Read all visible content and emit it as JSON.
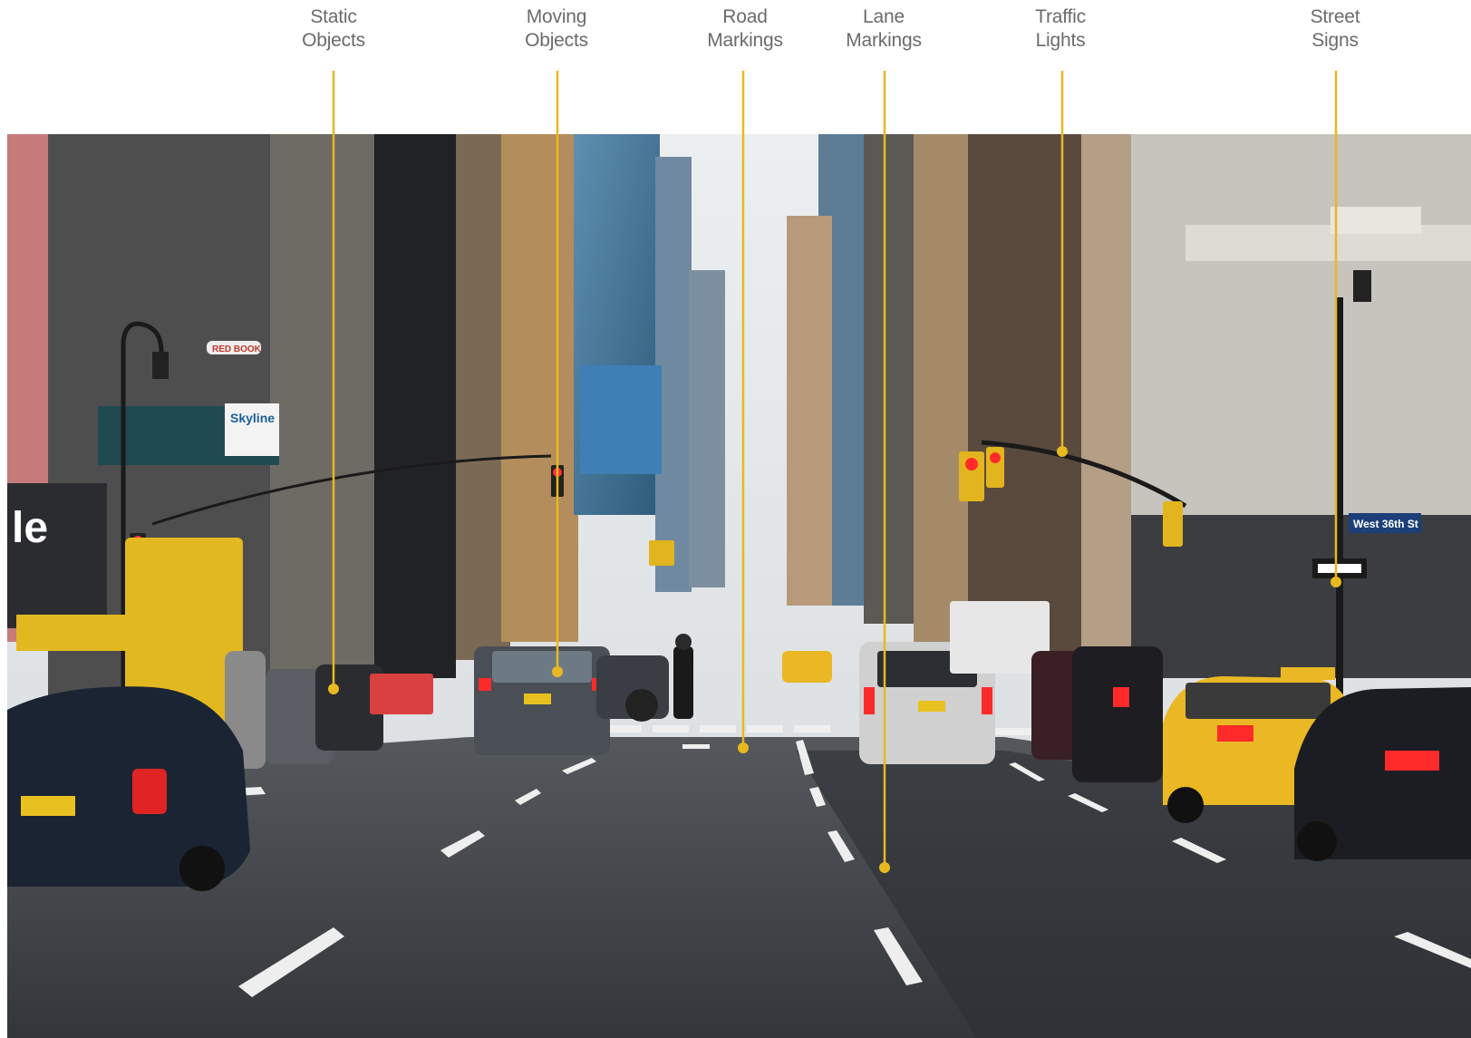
{
  "colors": {
    "leader_line": "#e8b820",
    "label_text": "#6b6b6b",
    "sky": "#dfe3e6",
    "asphalt": "#3a3d42",
    "lane_paint": "#f2f2f2",
    "taxi_yellow": "#e9b824"
  },
  "callouts": [
    {
      "id": "static-objects",
      "line1": "Static",
      "line2": "Objects"
    },
    {
      "id": "moving-objects",
      "line1": "Moving",
      "line2": "Objects"
    },
    {
      "id": "road-markings",
      "line1": "Road",
      "line2": "Markings"
    },
    {
      "id": "lane-markings",
      "line1": "Lane",
      "line2": "Markings"
    },
    {
      "id": "traffic-lights",
      "line1": "Traffic",
      "line2": "Lights"
    },
    {
      "id": "street-signs",
      "line1": "Street",
      "line2": "Signs"
    }
  ],
  "photo": {
    "billboard_sign": "Skyline",
    "storefront_sign": "le",
    "street_sign": "West 36th St",
    "brand_sign": "RED BOOK"
  }
}
